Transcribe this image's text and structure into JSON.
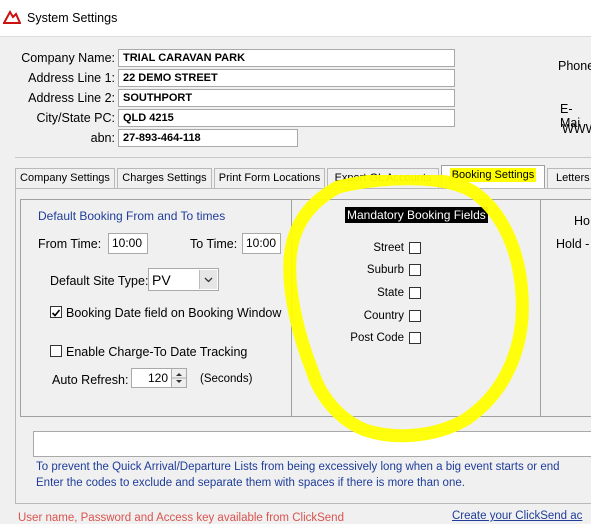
{
  "window": {
    "title": "System Settings",
    "icon": "caravan-app-icon"
  },
  "company": {
    "name_label": "Company Name:",
    "name_value": "TRIAL CARAVAN PARK",
    "addr1_label": "Address Line 1:",
    "addr1_value": "22 DEMO STREET",
    "addr2_label": "Address Line 2:",
    "addr2_value": "SOUTHPORT",
    "city_label": "City/State PC:",
    "city_value": "QLD 4215",
    "abn_label": "abn:",
    "abn_value": "27-893-464-118"
  },
  "right_labels": {
    "phone": "Phone",
    "email": "E-Mai",
    "www": "WWW"
  },
  "tabs": [
    {
      "label": "Company Settings"
    },
    {
      "label": "Charges Settings"
    },
    {
      "label": "Print Form Locations"
    },
    {
      "label": "Export GL Accounts"
    },
    {
      "label": "Booking Settings"
    },
    {
      "label": "Letters"
    }
  ],
  "booking": {
    "section_title": "Default Booking From and To times",
    "from_label": "From Time:",
    "from_value": "10:00",
    "to_label": "To Time:",
    "to_value": "10:00",
    "site_type_label": "Default Site Type:",
    "site_type_value": "PV",
    "date_field_label": "Booking Date field on Booking Window",
    "date_field_checked": true,
    "charge_to_label": "Enable Charge-To Date Tracking",
    "charge_to_checked": false,
    "auto_refresh_label": "Auto Refresh:",
    "auto_refresh_value": "120",
    "auto_refresh_unit": "(Seconds)"
  },
  "mandatory": {
    "title": "Mandatory Booking Fields",
    "fields": [
      {
        "label": "Street",
        "checked": false
      },
      {
        "label": "Suburb",
        "checked": false
      },
      {
        "label": "State",
        "checked": false
      },
      {
        "label": "Country",
        "checked": false
      },
      {
        "label": "Post Code",
        "checked": false
      }
    ]
  },
  "hold": {
    "label1": "Ho",
    "label2": "Hold -"
  },
  "exclude": {
    "value": "",
    "help_line1": "To prevent the Quick Arrival/Departure Lists from being excessively long when a big event starts or end",
    "help_line2": "Enter the codes to exclude and separate them with spaces if there is more than one."
  },
  "footer": {
    "clicksend_note": "User name, Password and Access key available from ClickSend",
    "clicksend_link": "Create your ClickSend ac"
  },
  "colors": {
    "highlight": "#ffff00",
    "link_blue": "#1f3d99",
    "note_red": "#d9534f"
  }
}
